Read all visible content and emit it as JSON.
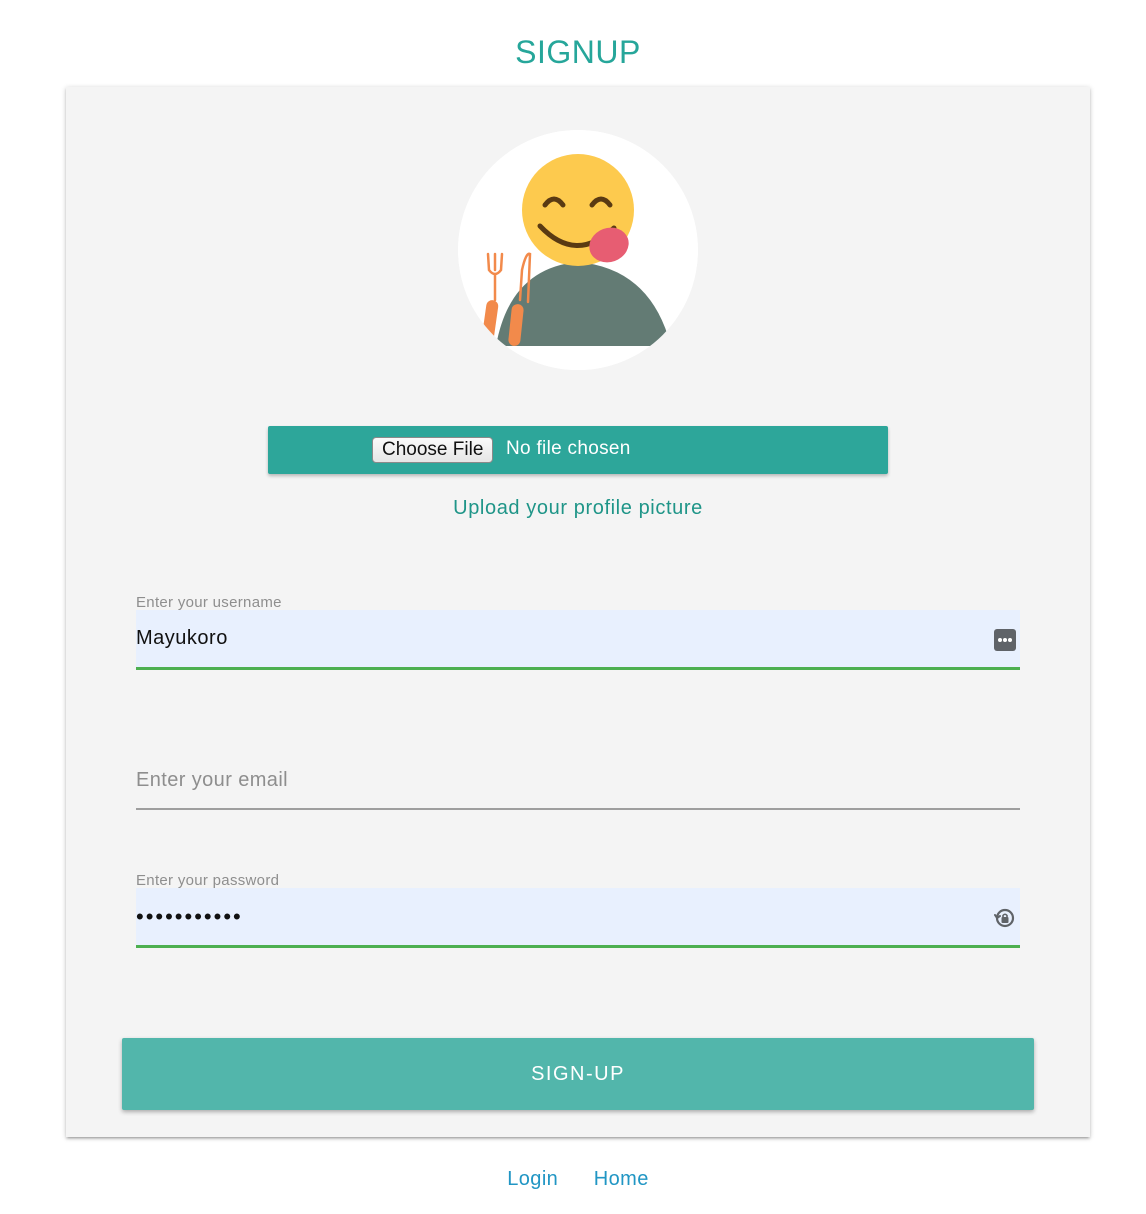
{
  "page": {
    "title": "SIGNUP"
  },
  "avatar": {
    "icon": "emoji-tongue-avatar-icon"
  },
  "file_upload": {
    "button_label": "Choose File",
    "status": "No file chosen",
    "caption": "Upload your profile picture"
  },
  "username": {
    "label": "Enter your username",
    "value": "Mayukoro"
  },
  "email": {
    "placeholder": "Enter your email",
    "value": ""
  },
  "password": {
    "label": "Enter your password",
    "masked_value": "•••••••••••"
  },
  "actions": {
    "signup_label": "SIGN-UP"
  },
  "footer": {
    "login_label": "Login",
    "home_label": "Home"
  },
  "colors": {
    "accent": "#26a69a",
    "button": "#52b6ab",
    "link": "#2196c4",
    "valid_underline": "#4caf50",
    "autofill_bg": "#e8f0fe"
  }
}
